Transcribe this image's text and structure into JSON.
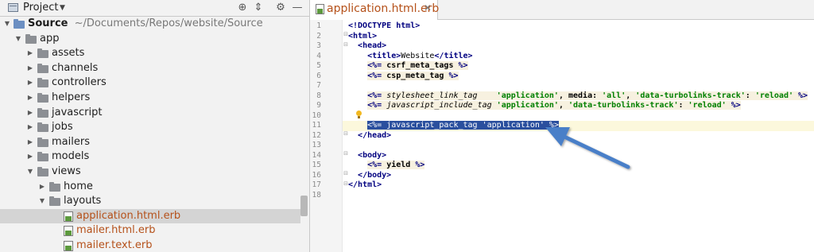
{
  "project_panel": {
    "title": "Project",
    "tree": [
      {
        "label": "Source",
        "path": "~/Documents/Repos/website/Source"
      },
      {
        "label": "app"
      },
      {
        "label": "assets"
      },
      {
        "label": "channels"
      },
      {
        "label": "controllers"
      },
      {
        "label": "helpers"
      },
      {
        "label": "javascript"
      },
      {
        "label": "jobs"
      },
      {
        "label": "mailers"
      },
      {
        "label": "models"
      },
      {
        "label": "views"
      },
      {
        "label": "home"
      },
      {
        "label": "layouts"
      },
      {
        "label": "application.html.erb"
      },
      {
        "label": "mailer.html.erb"
      },
      {
        "label": "mailer.text.erb"
      }
    ]
  },
  "editor": {
    "tab_label": "application.html.erb",
    "line_numbers": [
      "1",
      "2",
      "3",
      "4",
      "5",
      "6",
      "7",
      "8",
      "9",
      "10",
      "11",
      "12",
      "13",
      "14",
      "15",
      "16",
      "17",
      "18"
    ],
    "code": {
      "l1_doctype": "<!DOCTYPE html>",
      "l2": "<html>",
      "l3": "<head>",
      "l4_open": "<title>",
      "l4_text": "Website",
      "l4_close": "</title>",
      "l5": "csrf_meta_tags",
      "l6": "csp_meta_tag",
      "l8_method": "stylesheet_link_tag",
      "l8_args1": "'application'",
      "l8_media_key": ", media: ",
      "l8_all": "'all'",
      "l8_comma": ", ",
      "l8_tlt": "'data-turbolinks-track'",
      "l8_colon": ": ",
      "l8_reload": "'reload'",
      "l9_method": "javascript_include_tag",
      "l9_args1": "'application'",
      "l9_tlt": "'data-turbolinks-track'",
      "l9_reload": "'reload'",
      "l11_method": "javascript_pack_tag",
      "l11_arg": "'application'",
      "l12": "</head>",
      "l14": "<body>",
      "l15": "yield",
      "l16": "</body>",
      "l17": "</html>",
      "erb_open": "<%=",
      "erb_close": "%>"
    }
  },
  "annotation": {
    "arrow_color": "#4a7fc8"
  }
}
